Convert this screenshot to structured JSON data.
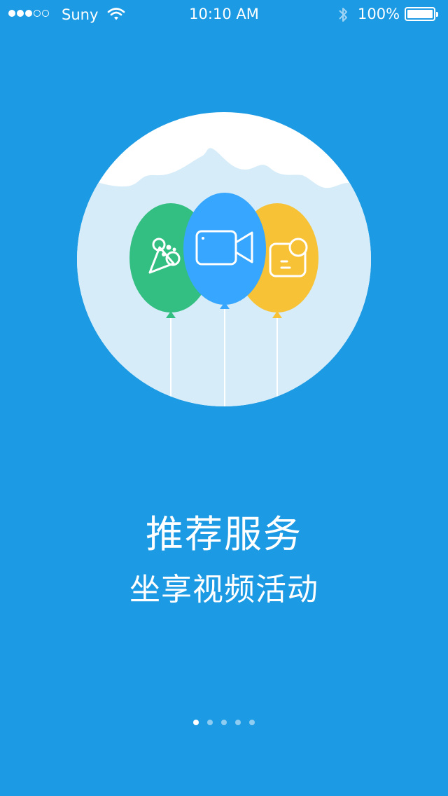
{
  "status_bar": {
    "carrier": "Suny",
    "time": "10:10 AM",
    "battery_percent": "100%",
    "signal_strength": 3,
    "signal_max": 5,
    "battery_level": 1.0
  },
  "onboarding": {
    "title": "推荐服务",
    "subtitle": "坐享视频活动"
  },
  "illustration": {
    "circle_color": "#ffffff",
    "sky_color": "#d6ecf8",
    "balloons": [
      {
        "icon": "party-popper-icon",
        "color": "#33bf82"
      },
      {
        "icon": "video-camera-icon",
        "color": "#36a6ff"
      },
      {
        "icon": "chat-bubble-icon",
        "color": "#f7c235"
      }
    ]
  },
  "pager": {
    "count": 5,
    "active_index": 0
  },
  "colors": {
    "background": "#1c9ae3",
    "text": "#ffffff"
  }
}
